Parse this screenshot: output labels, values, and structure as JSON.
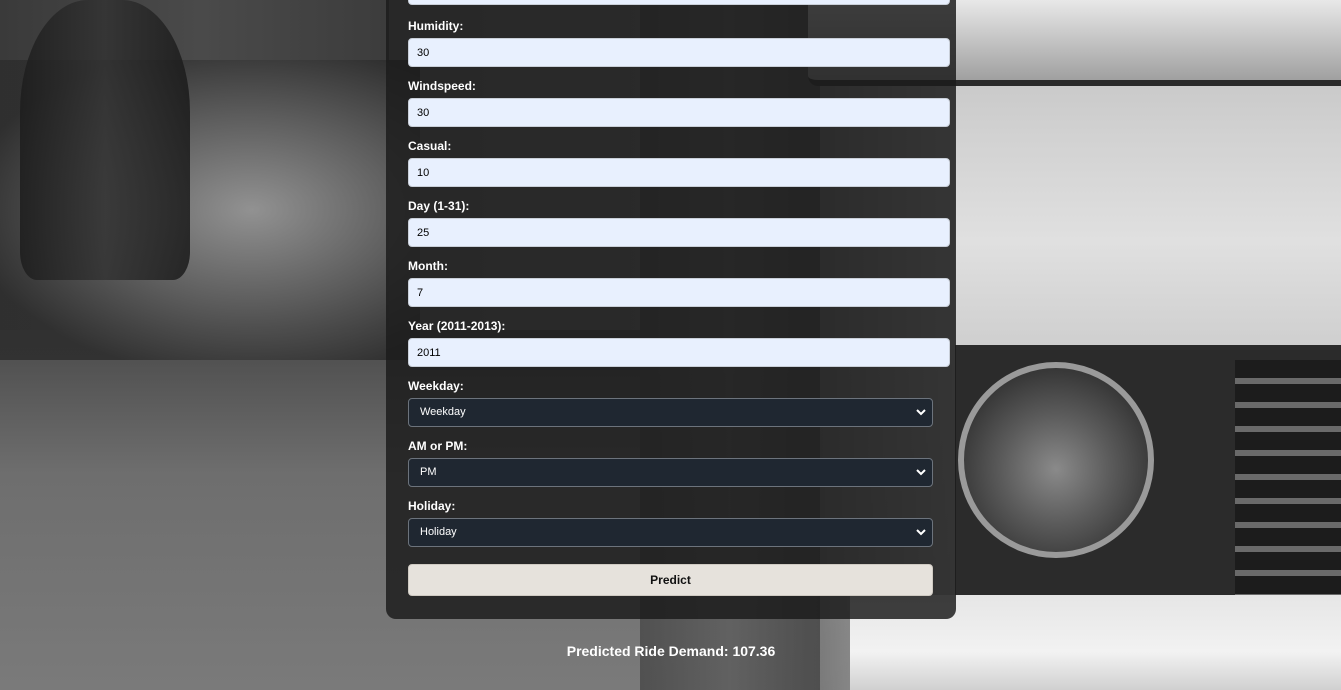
{
  "form": {
    "fields": [
      {
        "label": "Humidity:",
        "value": "30"
      },
      {
        "label": "Windspeed:",
        "value": "30"
      },
      {
        "label": "Casual:",
        "value": "10"
      },
      {
        "label": "Day (1-31):",
        "value": "25"
      },
      {
        "label": "Month:",
        "value": "7"
      },
      {
        "label": "Year (2011-2013):",
        "value": "2011"
      }
    ],
    "selects": [
      {
        "label": "Weekday:",
        "value": "Weekday"
      },
      {
        "label": "AM or PM:",
        "value": "PM"
      },
      {
        "label": "Holiday:",
        "value": "Holiday"
      }
    ],
    "predict_label": "Predict"
  },
  "result": {
    "text": "Predicted Ride Demand: 107.36"
  },
  "colors": {
    "input_bg": "#e8f0fe",
    "select_bg": "#1f2731",
    "button_bg": "#e6e2dc",
    "card_bg": "#1c1c1c"
  },
  "icons": {
    "select_arrow": "chevron-down-icon"
  }
}
